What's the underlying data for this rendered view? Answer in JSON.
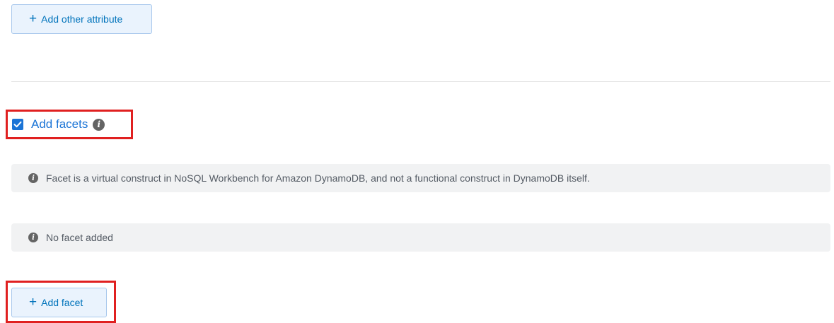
{
  "attributes": {
    "add_other_attribute_label": "Add other attribute"
  },
  "facets": {
    "checkbox_checked": true,
    "label": "Add facets",
    "info_icon": "info-icon",
    "virtual_notice": "Facet is a virtual construct in NoSQL Workbench for Amazon DynamoDB, and not a functional construct in DynamoDB itself.",
    "empty_notice": "No facet added",
    "add_facet_label": "Add facet"
  },
  "colors": {
    "accent": "#1b74d6",
    "button_bg": "#eaf3fd",
    "highlight": "#e02020",
    "alert_bg": "#f1f2f3"
  }
}
